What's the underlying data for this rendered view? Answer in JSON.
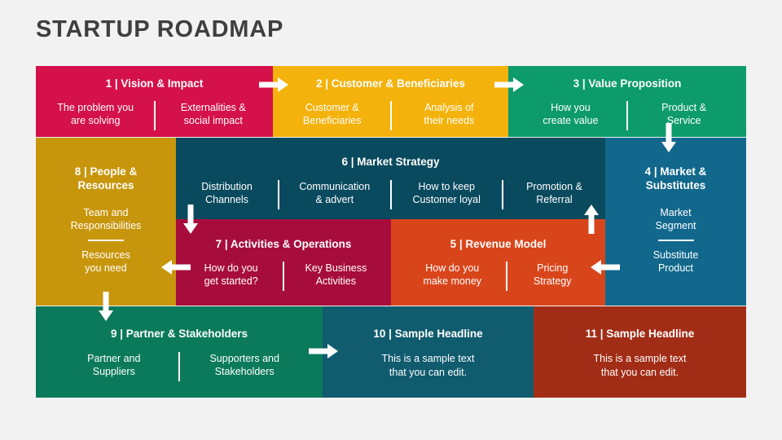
{
  "title": "STARTUP ROADMAP",
  "colors": {
    "background": "#f2f2f2",
    "title_text": "#3f3f3f",
    "crimson": "#d4114a",
    "gold": "#f4b20c",
    "green": "#0d9b6c",
    "dark_gold": "#c8960c",
    "dark_teal": "#0a4a5e",
    "deep_red": "#a70d3c",
    "orange": "#d9451b",
    "blue": "#11688c",
    "dark_green": "#0b7a5a",
    "bottom_teal": "#105b6e",
    "brick_red": "#a22d16",
    "arrow": "#ffffff"
  },
  "boxes": [
    {
      "id": "vision-impact",
      "number": "1",
      "title": "1 | Vision & Impact",
      "color": "crimson",
      "subs": [
        "The problem you\nare solving",
        "Externalities &\nsocial impact"
      ]
    },
    {
      "id": "customer-beneficiaries",
      "number": "2",
      "title": "2 | Customer &  Beneficiaries",
      "color": "gold",
      "subs": [
        "Customer &\nBeneficiaries",
        "Analysis of\ntheir needs"
      ]
    },
    {
      "id": "value-proposition",
      "number": "3",
      "title": "3 | Value Proposition",
      "color": "green",
      "subs": [
        "How you\ncreate value",
        "Product &\nService"
      ]
    },
    {
      "id": "people-resources",
      "number": "8",
      "title": "8 | People &\nResources",
      "color": "dark_gold",
      "stacked": [
        "Team and\nResponsibilities",
        "Resources\nyou need"
      ]
    },
    {
      "id": "market-strategy",
      "number": "6",
      "title": "6 | Market Strategy",
      "color": "dark_teal",
      "subs": [
        "Distribution\nChannels",
        "Communication\n& advert",
        "How to keep\nCustomer loyal",
        "Promotion &\nReferral"
      ]
    },
    {
      "id": "market-substitutes",
      "number": "4",
      "title": "4 | Market &\nSubstitutes",
      "color": "blue",
      "stacked": [
        "Market\nSegment",
        "Substitute\nProduct"
      ]
    },
    {
      "id": "activities-operations",
      "number": "7",
      "title": "7 | Activities & Operations",
      "color": "deep_red",
      "subs": [
        "How do you\nget started?",
        "Key Business\nActivities"
      ]
    },
    {
      "id": "revenue-model",
      "number": "5",
      "title": "5 | Revenue Model",
      "color": "orange",
      "subs": [
        "How do you\nmake money",
        "Pricing\nStrategy"
      ]
    },
    {
      "id": "partner-stakeholders",
      "number": "9",
      "title": "9 | Partner & Stakeholders",
      "color": "dark_green",
      "subs": [
        "Partner and\nSuppliers",
        "Supporters and\nStakeholders"
      ]
    },
    {
      "id": "sample-headline-10",
      "number": "10",
      "title": "10 | Sample Headline",
      "color": "bottom_teal",
      "body": "This is a sample text\nthat you can edit."
    },
    {
      "id": "sample-headline-11",
      "number": "11",
      "title": "11 | Sample Headline",
      "color": "brick_red",
      "body": "This is a sample text\nthat you can edit."
    }
  ],
  "arrows": [
    {
      "id": "arrow-1-to-2",
      "direction": "right"
    },
    {
      "id": "arrow-2-to-3",
      "direction": "right"
    },
    {
      "id": "arrow-3-to-4",
      "direction": "down"
    },
    {
      "id": "arrow-4-to-5",
      "direction": "left"
    },
    {
      "id": "arrow-5-to-6",
      "direction": "up"
    },
    {
      "id": "arrow-6-to-7",
      "direction": "down"
    },
    {
      "id": "arrow-7-to-8",
      "direction": "left"
    },
    {
      "id": "arrow-8-to-9",
      "direction": "down"
    },
    {
      "id": "arrow-9-to-10",
      "direction": "right"
    }
  ]
}
